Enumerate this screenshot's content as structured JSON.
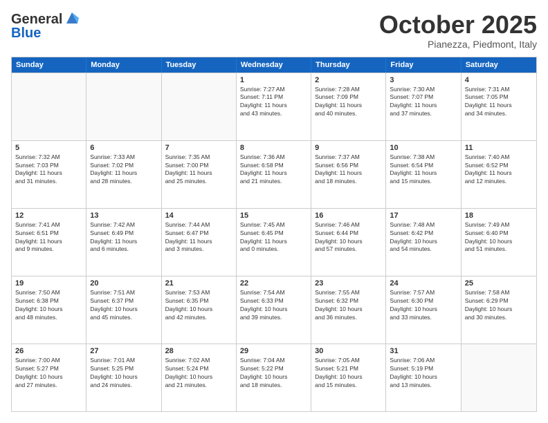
{
  "header": {
    "logo_general": "General",
    "logo_blue": "Blue",
    "month_title": "October 2025",
    "location": "Pianezza, Piedmont, Italy"
  },
  "days_of_week": [
    "Sunday",
    "Monday",
    "Tuesday",
    "Wednesday",
    "Thursday",
    "Friday",
    "Saturday"
  ],
  "rows": [
    [
      {
        "day": "",
        "text": ""
      },
      {
        "day": "",
        "text": ""
      },
      {
        "day": "",
        "text": ""
      },
      {
        "day": "1",
        "text": "Sunrise: 7:27 AM\nSunset: 7:11 PM\nDaylight: 11 hours\nand 43 minutes."
      },
      {
        "day": "2",
        "text": "Sunrise: 7:28 AM\nSunset: 7:09 PM\nDaylight: 11 hours\nand 40 minutes."
      },
      {
        "day": "3",
        "text": "Sunrise: 7:30 AM\nSunset: 7:07 PM\nDaylight: 11 hours\nand 37 minutes."
      },
      {
        "day": "4",
        "text": "Sunrise: 7:31 AM\nSunset: 7:05 PM\nDaylight: 11 hours\nand 34 minutes."
      }
    ],
    [
      {
        "day": "5",
        "text": "Sunrise: 7:32 AM\nSunset: 7:03 PM\nDaylight: 11 hours\nand 31 minutes."
      },
      {
        "day": "6",
        "text": "Sunrise: 7:33 AM\nSunset: 7:02 PM\nDaylight: 11 hours\nand 28 minutes."
      },
      {
        "day": "7",
        "text": "Sunrise: 7:35 AM\nSunset: 7:00 PM\nDaylight: 11 hours\nand 25 minutes."
      },
      {
        "day": "8",
        "text": "Sunrise: 7:36 AM\nSunset: 6:58 PM\nDaylight: 11 hours\nand 21 minutes."
      },
      {
        "day": "9",
        "text": "Sunrise: 7:37 AM\nSunset: 6:56 PM\nDaylight: 11 hours\nand 18 minutes."
      },
      {
        "day": "10",
        "text": "Sunrise: 7:38 AM\nSunset: 6:54 PM\nDaylight: 11 hours\nand 15 minutes."
      },
      {
        "day": "11",
        "text": "Sunrise: 7:40 AM\nSunset: 6:52 PM\nDaylight: 11 hours\nand 12 minutes."
      }
    ],
    [
      {
        "day": "12",
        "text": "Sunrise: 7:41 AM\nSunset: 6:51 PM\nDaylight: 11 hours\nand 9 minutes."
      },
      {
        "day": "13",
        "text": "Sunrise: 7:42 AM\nSunset: 6:49 PM\nDaylight: 11 hours\nand 6 minutes."
      },
      {
        "day": "14",
        "text": "Sunrise: 7:44 AM\nSunset: 6:47 PM\nDaylight: 11 hours\nand 3 minutes."
      },
      {
        "day": "15",
        "text": "Sunrise: 7:45 AM\nSunset: 6:45 PM\nDaylight: 11 hours\nand 0 minutes."
      },
      {
        "day": "16",
        "text": "Sunrise: 7:46 AM\nSunset: 6:44 PM\nDaylight: 10 hours\nand 57 minutes."
      },
      {
        "day": "17",
        "text": "Sunrise: 7:48 AM\nSunset: 6:42 PM\nDaylight: 10 hours\nand 54 minutes."
      },
      {
        "day": "18",
        "text": "Sunrise: 7:49 AM\nSunset: 6:40 PM\nDaylight: 10 hours\nand 51 minutes."
      }
    ],
    [
      {
        "day": "19",
        "text": "Sunrise: 7:50 AM\nSunset: 6:38 PM\nDaylight: 10 hours\nand 48 minutes."
      },
      {
        "day": "20",
        "text": "Sunrise: 7:51 AM\nSunset: 6:37 PM\nDaylight: 10 hours\nand 45 minutes."
      },
      {
        "day": "21",
        "text": "Sunrise: 7:53 AM\nSunset: 6:35 PM\nDaylight: 10 hours\nand 42 minutes."
      },
      {
        "day": "22",
        "text": "Sunrise: 7:54 AM\nSunset: 6:33 PM\nDaylight: 10 hours\nand 39 minutes."
      },
      {
        "day": "23",
        "text": "Sunrise: 7:55 AM\nSunset: 6:32 PM\nDaylight: 10 hours\nand 36 minutes."
      },
      {
        "day": "24",
        "text": "Sunrise: 7:57 AM\nSunset: 6:30 PM\nDaylight: 10 hours\nand 33 minutes."
      },
      {
        "day": "25",
        "text": "Sunrise: 7:58 AM\nSunset: 6:29 PM\nDaylight: 10 hours\nand 30 minutes."
      }
    ],
    [
      {
        "day": "26",
        "text": "Sunrise: 7:00 AM\nSunset: 5:27 PM\nDaylight: 10 hours\nand 27 minutes."
      },
      {
        "day": "27",
        "text": "Sunrise: 7:01 AM\nSunset: 5:25 PM\nDaylight: 10 hours\nand 24 minutes."
      },
      {
        "day": "28",
        "text": "Sunrise: 7:02 AM\nSunset: 5:24 PM\nDaylight: 10 hours\nand 21 minutes."
      },
      {
        "day": "29",
        "text": "Sunrise: 7:04 AM\nSunset: 5:22 PM\nDaylight: 10 hours\nand 18 minutes."
      },
      {
        "day": "30",
        "text": "Sunrise: 7:05 AM\nSunset: 5:21 PM\nDaylight: 10 hours\nand 15 minutes."
      },
      {
        "day": "31",
        "text": "Sunrise: 7:06 AM\nSunset: 5:19 PM\nDaylight: 10 hours\nand 13 minutes."
      },
      {
        "day": "",
        "text": ""
      }
    ]
  ]
}
